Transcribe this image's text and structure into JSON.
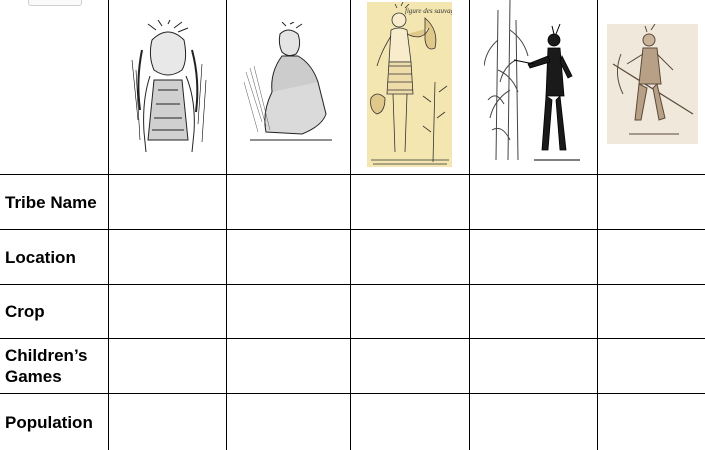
{
  "table": {
    "row_labels": [
      "Tribe Name",
      "Location",
      "Crop",
      "Children’s Games",
      "Population"
    ],
    "images": [
      {
        "icon": "native-chief-feather-headdress-illustration"
      },
      {
        "icon": "native-man-crouching-illustration"
      },
      {
        "icon": "native-woman-holding-horn-illustration",
        "caption": "figure des sauvag"
      },
      {
        "icon": "native-man-with-cornstalks-illustration"
      },
      {
        "icon": "native-warrior-with-spear-illustration"
      }
    ]
  }
}
